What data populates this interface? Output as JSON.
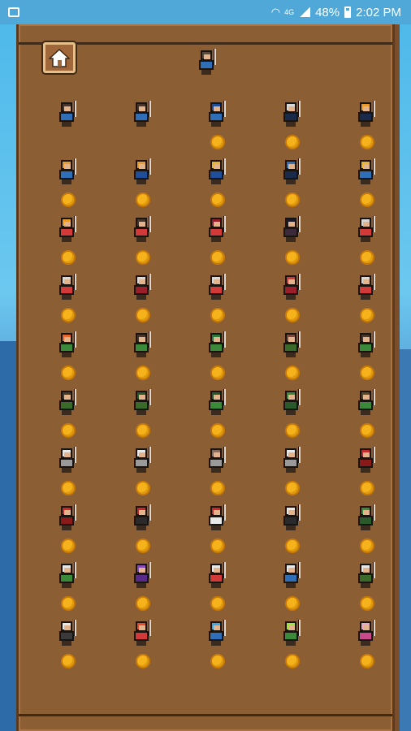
{
  "status_bar": {
    "network": "4G",
    "battery": "48%",
    "time": "2:02 PM"
  },
  "colors": {
    "panel": "#8b5e34",
    "coin": "#f5b21a",
    "sky": "#4cb8ea"
  },
  "home_button": {
    "icon": "home-icon"
  },
  "current_hero": {
    "palette": [
      "#5b4a3a",
      "#2e6fb8",
      "#e3b48c"
    ]
  },
  "coin_symbol": "",
  "heroes": [
    {
      "palette": [
        "#4a3628",
        "#2e6fb8"
      ],
      "coin": false
    },
    {
      "palette": [
        "#4a3628",
        "#2e6fb8"
      ],
      "coin": false
    },
    {
      "palette": [
        "#1f4e9a",
        "#2e6fb8"
      ],
      "coin": true
    },
    {
      "palette": [
        "#d8d8d8",
        "#1a2a4a"
      ],
      "coin": true
    },
    {
      "palette": [
        "#e89a2a",
        "#1a2a4a"
      ],
      "coin": true
    },
    {
      "palette": [
        "#e89a2a",
        "#2e6fb8"
      ],
      "coin": true
    },
    {
      "palette": [
        "#e89a2a",
        "#1f4e9a"
      ],
      "coin": true
    },
    {
      "palette": [
        "#e8b42a",
        "#1f4e9a"
      ],
      "coin": true
    },
    {
      "palette": [
        "#2e6fb8",
        "#1a2a4a"
      ],
      "coin": true
    },
    {
      "palette": [
        "#e8b42a",
        "#2e6fb8"
      ],
      "coin": true
    },
    {
      "palette": [
        "#e89a2a",
        "#d23a3a"
      ],
      "coin": true
    },
    {
      "palette": [
        "#4a3628",
        "#d23a3a"
      ],
      "coin": true
    },
    {
      "palette": [
        "#9a1f2a",
        "#d23a3a"
      ],
      "coin": true
    },
    {
      "palette": [
        "#1a1a2a",
        "#3a2a3a"
      ],
      "coin": true
    },
    {
      "palette": [
        "#d8d8d8",
        "#d23a3a"
      ],
      "coin": true
    },
    {
      "palette": [
        "#d8d8d8",
        "#d23a3a"
      ],
      "coin": true
    },
    {
      "palette": [
        "#d8d8d8",
        "#9a1f2a"
      ],
      "coin": true
    },
    {
      "palette": [
        "#d8d8d8",
        "#d23a3a"
      ],
      "coin": true
    },
    {
      "palette": [
        "#d23a3a",
        "#9a1f2a"
      ],
      "coin": true
    },
    {
      "palette": [
        "#d8d8d8",
        "#d23a3a"
      ],
      "coin": true
    },
    {
      "palette": [
        "#e8642a",
        "#3a8a3a"
      ],
      "coin": true
    },
    {
      "palette": [
        "#4a3628",
        "#3a8a3a"
      ],
      "coin": true
    },
    {
      "palette": [
        "#2a7a3a",
        "#3a8a3a"
      ],
      "coin": true
    },
    {
      "palette": [
        "#7a4a3a",
        "#3a6a2a"
      ],
      "coin": true
    },
    {
      "palette": [
        "#4a3628",
        "#3a8a3a"
      ],
      "coin": true
    },
    {
      "palette": [
        "#4a3a2a",
        "#3a6a2a"
      ],
      "coin": true
    },
    {
      "palette": [
        "#2a5a2a",
        "#3a6a2a"
      ],
      "coin": true
    },
    {
      "palette": [
        "#2a5a2a",
        "#3a8a3a"
      ],
      "coin": true
    },
    {
      "palette": [
        "#3a8a3a",
        "#2a5a2a"
      ],
      "coin": true
    },
    {
      "palette": [
        "#5a4a2a",
        "#3a8a3a"
      ],
      "coin": true
    },
    {
      "palette": [
        "#e8e8e8",
        "#9a9a9a"
      ],
      "coin": true
    },
    {
      "palette": [
        "#e8e8e8",
        "#9a9a9a"
      ],
      "coin": true
    },
    {
      "palette": [
        "#8a6a5a",
        "#9a9a9a"
      ],
      "coin": true
    },
    {
      "palette": [
        "#e8e8e8",
        "#9a9a9a"
      ],
      "coin": true
    },
    {
      "palette": [
        "#c82a2a",
        "#8a1a1a"
      ],
      "coin": true
    },
    {
      "palette": [
        "#c82a2a",
        "#8a1a1a"
      ],
      "coin": true
    },
    {
      "palette": [
        "#c82a2a",
        "#2a2a2a"
      ],
      "coin": true
    },
    {
      "palette": [
        "#c82a2a",
        "#e8e8e8"
      ],
      "coin": true
    },
    {
      "palette": [
        "#e8e8e8",
        "#2a2a2a"
      ],
      "coin": true
    },
    {
      "palette": [
        "#3a8a3a",
        "#2a5a2a"
      ],
      "coin": true
    },
    {
      "palette": [
        "#e8e8e8",
        "#3a8a3a"
      ],
      "coin": true
    },
    {
      "palette": [
        "#8a4ab8",
        "#5a2a8a"
      ],
      "coin": true
    },
    {
      "palette": [
        "#e8e8e8",
        "#d23a3a"
      ],
      "coin": true
    },
    {
      "palette": [
        "#e8e8e8",
        "#2e6fb8"
      ],
      "coin": true
    },
    {
      "palette": [
        "#e8e8e8",
        "#3a6a2a"
      ],
      "coin": true
    },
    {
      "palette": [
        "#e8e8e8",
        "#3a3a3a"
      ],
      "coin": true
    },
    {
      "palette": [
        "#e84a2a",
        "#d23a3a"
      ],
      "coin": true
    },
    {
      "palette": [
        "#3aaae8",
        "#2e6fb8"
      ],
      "coin": true
    },
    {
      "palette": [
        "#9ae83a",
        "#3a8a3a"
      ],
      "coin": true
    },
    {
      "palette": [
        "#e8a8c8",
        "#c84a8a"
      ],
      "coin": true
    }
  ]
}
